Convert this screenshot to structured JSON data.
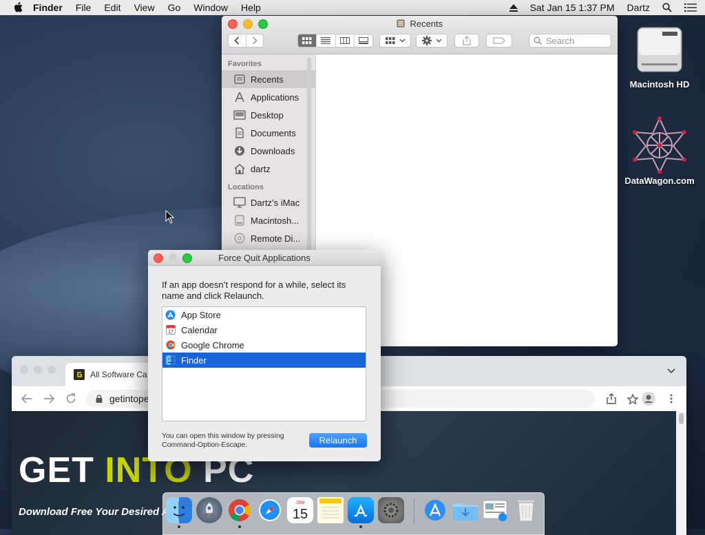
{
  "menubar": {
    "app_name": "Finder",
    "items": [
      "File",
      "Edit",
      "View",
      "Go",
      "Window",
      "Help"
    ],
    "datetime": "Sat Jan 15  1:37 PM",
    "user": "Dartz"
  },
  "desktop": {
    "icons": [
      {
        "label": "Macintosh HD",
        "icon": "hard-drive-icon"
      },
      {
        "label": "DataWagon.com",
        "icon": "star-logo-icon"
      }
    ]
  },
  "finder": {
    "title": "Recents",
    "search_placeholder": "Search",
    "favorites_header": "Favorites",
    "favorites": [
      {
        "label": "Recents",
        "icon": "recents-icon",
        "selected": true
      },
      {
        "label": "Applications",
        "icon": "applications-icon"
      },
      {
        "label": "Desktop",
        "icon": "desktop-icon"
      },
      {
        "label": "Documents",
        "icon": "documents-icon"
      },
      {
        "label": "Downloads",
        "icon": "downloads-icon"
      },
      {
        "label": "dartz",
        "icon": "home-icon"
      }
    ],
    "locations_header": "Locations",
    "locations": [
      {
        "label": "Dartz’s iMac",
        "icon": "imac-icon"
      },
      {
        "label": "Macintosh...",
        "icon": "disk-icon"
      },
      {
        "label": "Remote Di...",
        "icon": "remote-disc-icon"
      }
    ]
  },
  "chrome": {
    "tab_title": "All Software Ca",
    "url": "getintope",
    "page": {
      "logo_part1": "GET ",
      "logo_part2": "INTO",
      "logo_part3": " PC",
      "tagline": "Download Free Your Desired A"
    }
  },
  "force_quit": {
    "title": "Force Quit Applications",
    "message": "If an app doesn’t respond for a while, select its name and click Relaunch.",
    "apps": [
      {
        "name": "App Store",
        "icon": "app-store-icon",
        "selected": false
      },
      {
        "name": "Calendar",
        "icon": "calendar-icon",
        "selected": false
      },
      {
        "name": "Google Chrome",
        "icon": "chrome-icon",
        "selected": false
      },
      {
        "name": "Finder",
        "icon": "finder-icon",
        "selected": true
      }
    ],
    "hint": "You can open this window by pressing Command-Option-Escape.",
    "button": "Relaunch"
  },
  "dock": {
    "calendar_day": "15",
    "calendar_month": "JAN",
    "items": [
      "finder-icon",
      "launchpad-icon",
      "chrome-icon",
      "safari-icon",
      "calendar-icon",
      "notes-icon",
      "app-store-icon",
      "system-preferences-icon",
      "applications-folder-icon",
      "downloads-folder-icon",
      "preview-icon",
      "trash-icon"
    ]
  },
  "colors": {
    "selection": "#1a63d6",
    "accent_logo": "#c8d400"
  }
}
